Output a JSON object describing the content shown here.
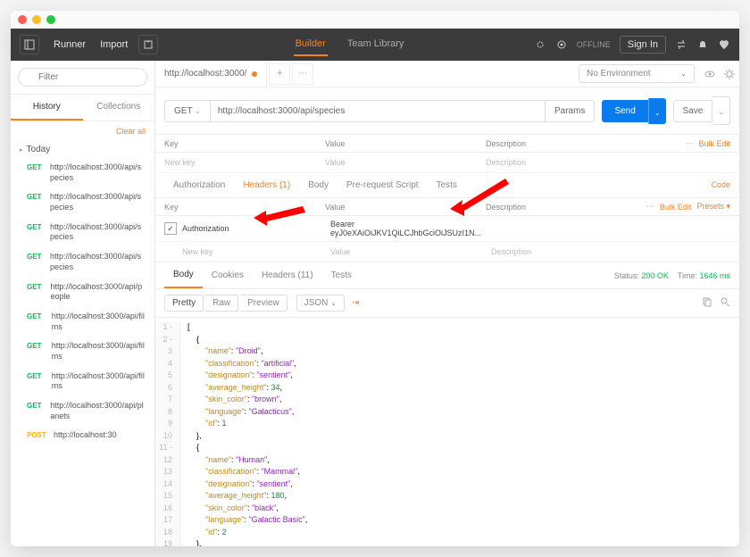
{
  "titlebar": {},
  "topbar": {
    "runner": "Runner",
    "import": "Import",
    "builder": "Builder",
    "team_library": "Team Library",
    "offline": "OFFLINE",
    "signin": "Sign In"
  },
  "sidebar": {
    "filter_placeholder": "Filter",
    "history_tab": "History",
    "collections_tab": "Collections",
    "clear_all": "Clear all",
    "day_label": "Today",
    "items": [
      {
        "method": "GET",
        "url": "http://localhost:3000/api/species"
      },
      {
        "method": "GET",
        "url": "http://localhost:3000/api/species"
      },
      {
        "method": "GET",
        "url": "http://localhost:3000/api/species"
      },
      {
        "method": "GET",
        "url": "http://localhost:3000/api/species"
      },
      {
        "method": "GET",
        "url": "http://localhost:3000/api/people"
      },
      {
        "method": "GET",
        "url": "http://localhost:3000/api/films"
      },
      {
        "method": "GET",
        "url": "http://localhost:3000/api/films"
      },
      {
        "method": "GET",
        "url": "http://localhost:3000/api/films"
      },
      {
        "method": "GET",
        "url": "http://localhost:3000/api/planets"
      },
      {
        "method": "POST",
        "url": "http://localhost:30"
      }
    ]
  },
  "tab": {
    "label": "http://localhost:3000/"
  },
  "env": {
    "label": "No Environment"
  },
  "request": {
    "method": "GET",
    "url": "http://localhost:3000/api/species",
    "params": "Params",
    "send": "Send",
    "save": "Save"
  },
  "params_grid": {
    "key": "Key",
    "value": "Value",
    "desc": "Description",
    "bulk": "Bulk Edit",
    "new_key": "New key",
    "new_value": "Value",
    "new_desc": "Description"
  },
  "reqtabs": {
    "auth": "Authorization",
    "headers": "Headers (1)",
    "body": "Body",
    "prs": "Pre-request Script",
    "tests": "Tests",
    "code": "Code"
  },
  "headers_grid": {
    "key": "Key",
    "value": "Value",
    "desc": "Description",
    "bulk": "Bulk Edit",
    "presets": "Presets",
    "row_key": "Authorization",
    "row_value": "Bearer eyJ0eXAiOiJKV1QiLCJhbGciOiJSUzI1N...",
    "new_key": "New key",
    "new_value": "Value",
    "new_desc": "Description"
  },
  "resptabs": {
    "body": "Body",
    "cookies": "Cookies",
    "headers": "Headers (11)",
    "tests": "Tests",
    "status_label": "Status:",
    "status_value": "200 OK",
    "time_label": "Time:",
    "time_value": "1646 ms"
  },
  "fmt": {
    "pretty": "Pretty",
    "raw": "Raw",
    "preview": "Preview",
    "json": "JSON"
  },
  "response_body": [
    {
      "n": 1,
      "t": "[",
      "caret": "-"
    },
    {
      "n": 2,
      "t": "    {",
      "caret": "-"
    },
    {
      "n": 3,
      "t": "        \"name\": \"Droid\","
    },
    {
      "n": 4,
      "t": "        \"classification\": \"artificial\","
    },
    {
      "n": 5,
      "t": "        \"designation\": \"sentient\","
    },
    {
      "n": 6,
      "t": "        \"average_height\": 34,"
    },
    {
      "n": 7,
      "t": "        \"skin_color\": \"brown\","
    },
    {
      "n": 8,
      "t": "        \"language\": \"Galacticus\","
    },
    {
      "n": 9,
      "t": "        \"id\": 1"
    },
    {
      "n": 10,
      "t": "    },"
    },
    {
      "n": 11,
      "t": "    {",
      "caret": "-"
    },
    {
      "n": 12,
      "t": "        \"name\": \"Human\","
    },
    {
      "n": 13,
      "t": "        \"classification\": \"Mammal\","
    },
    {
      "n": 14,
      "t": "        \"designation\": \"sentient\","
    },
    {
      "n": 15,
      "t": "        \"average_height\": 180,"
    },
    {
      "n": 16,
      "t": "        \"skin_color\": \"black\","
    },
    {
      "n": 17,
      "t": "        \"language\": \"Galactic Basic\","
    },
    {
      "n": 18,
      "t": "        \"id\": 2"
    },
    {
      "n": 19,
      "t": "    },"
    }
  ]
}
